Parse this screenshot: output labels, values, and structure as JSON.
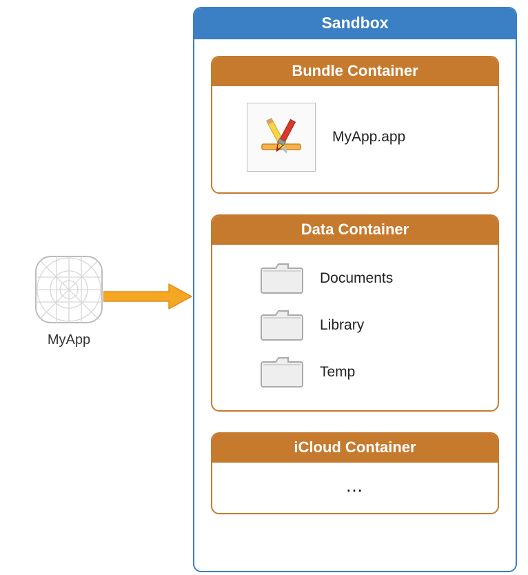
{
  "source_app": {
    "label": "MyApp"
  },
  "sandbox": {
    "title": "Sandbox",
    "containers": [
      {
        "title": "Bundle Container",
        "items": [
          {
            "type": "app",
            "label": "MyApp.app"
          }
        ]
      },
      {
        "title": "Data Container",
        "items": [
          {
            "type": "folder",
            "label": "Documents"
          },
          {
            "type": "folder",
            "label": "Library"
          },
          {
            "type": "folder",
            "label": "Temp"
          }
        ]
      },
      {
        "title": "iCloud Container",
        "ellipsis": "…"
      }
    ]
  },
  "colors": {
    "sandbox_border": "#3b7fc4",
    "container_accent": "#c67a2e",
    "arrow": "#f5a623"
  }
}
